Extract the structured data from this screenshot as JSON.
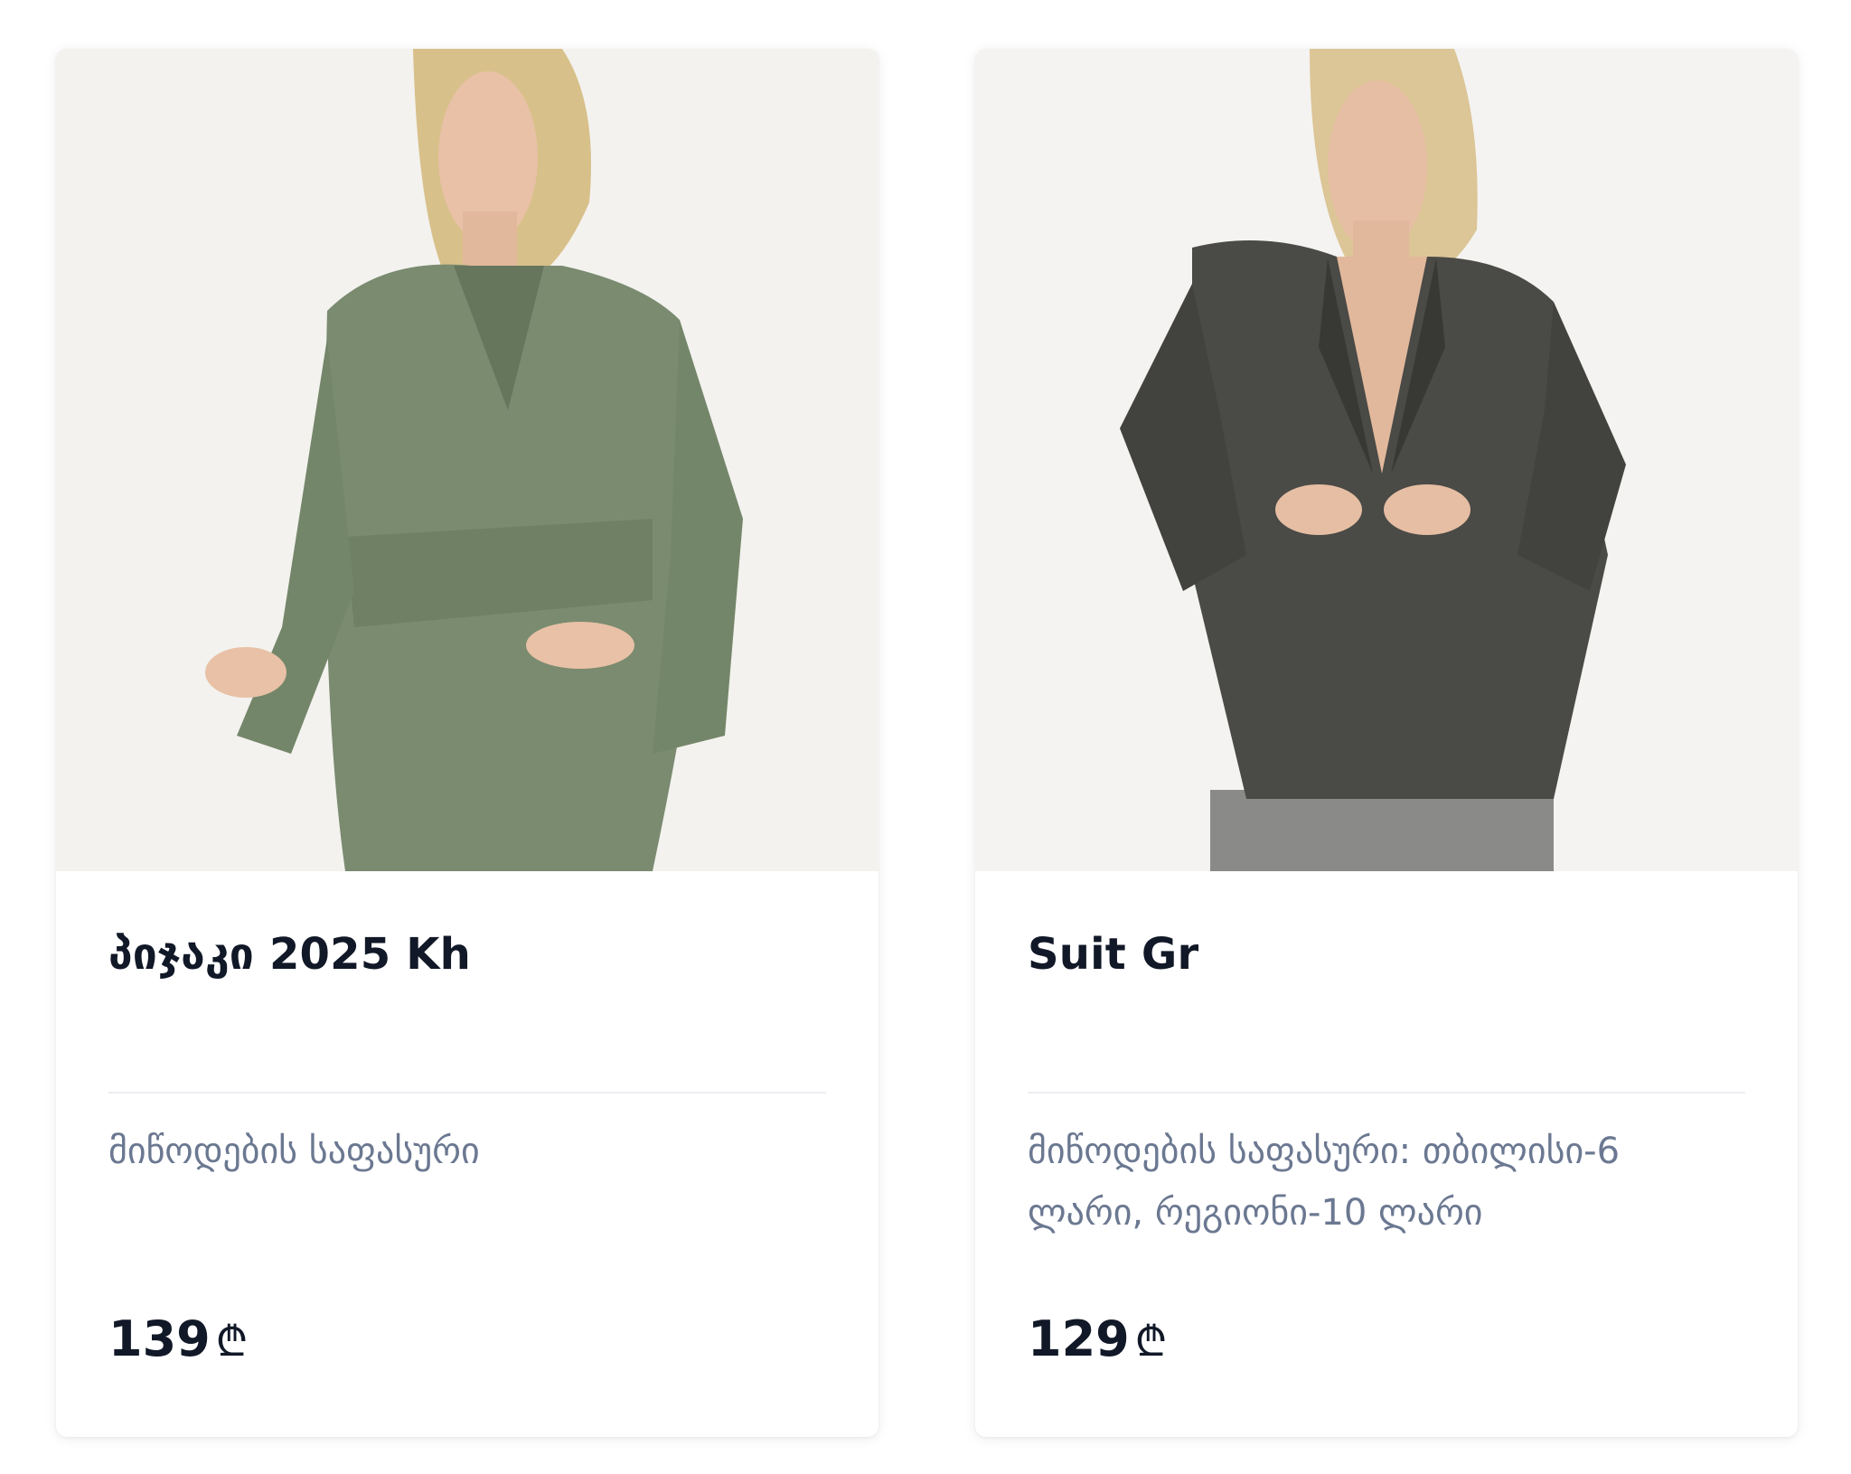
{
  "products": [
    {
      "title": "პიჯაკი 2025 Kh",
      "delivery": "მიწოდების საფასური",
      "price": "139",
      "currency": "₾",
      "image_alt": "green belted blazer",
      "colors": {
        "garment": "#7a8b70",
        "garment_shadow": "#66765d",
        "hair": "#d8c08a",
        "skin": "#e8c1a6"
      }
    },
    {
      "title": "Suit Gr",
      "delivery": "მიწოდების საფასური: თბილისი-6 ლარი, რეგიონი-10 ლარი",
      "price": "129",
      "currency": "₾",
      "image_alt": "dark grey blazer",
      "colors": {
        "garment": "#4a4a46",
        "garment_shadow": "#383835",
        "hair": "#dcc596",
        "skin": "#e6bea3"
      }
    }
  ]
}
